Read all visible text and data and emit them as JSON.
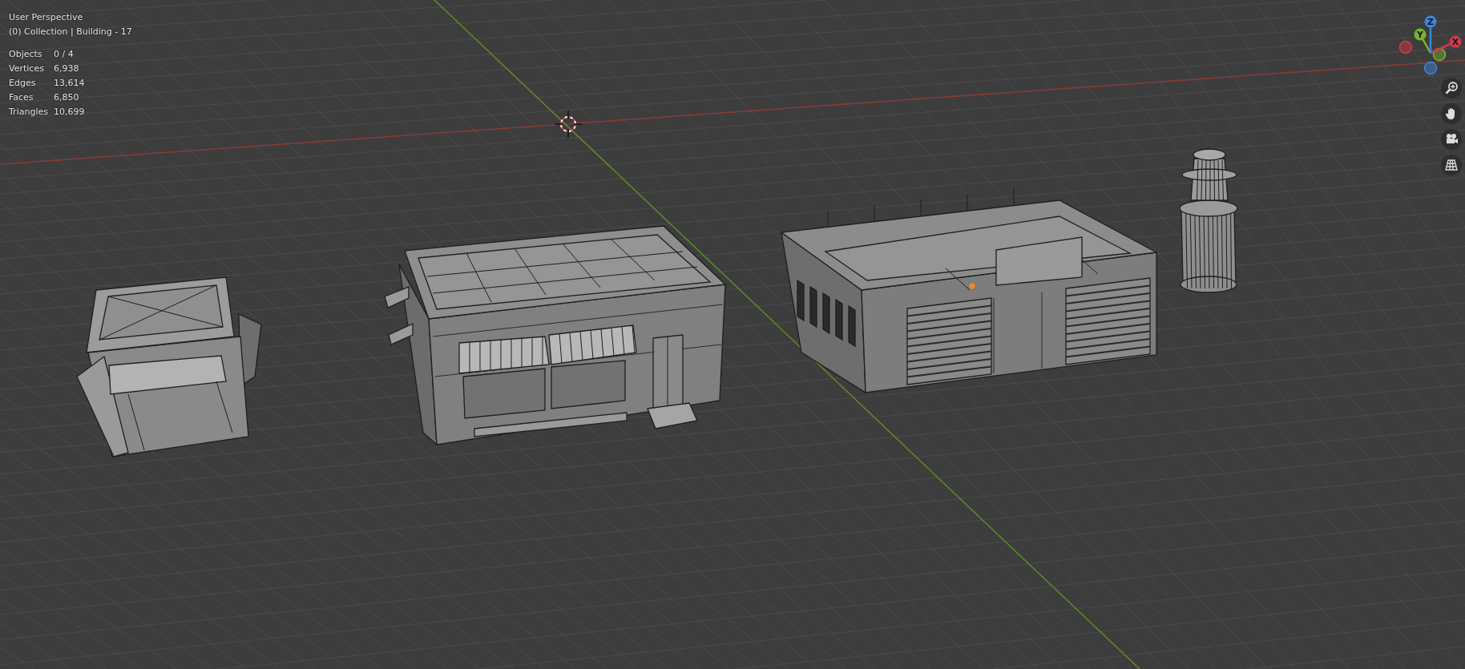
{
  "viewport": {
    "view": "User Perspective",
    "context": "(0) Collection | Building - 17"
  },
  "stats": [
    {
      "label": "Objects",
      "value": "0 / 4"
    },
    {
      "label": "Vertices",
      "value": "6,938"
    },
    {
      "label": "Edges",
      "value": "13,614"
    },
    {
      "label": "Faces",
      "value": "6,850"
    },
    {
      "label": "Triangles",
      "value": "10,699"
    }
  ],
  "gizmo": {
    "axes": [
      {
        "label": "X",
        "color": "#d6364a"
      },
      {
        "label": "Y",
        "color": "#7ab32e"
      },
      {
        "label": "Z",
        "color": "#3b86e0"
      }
    ]
  }
}
